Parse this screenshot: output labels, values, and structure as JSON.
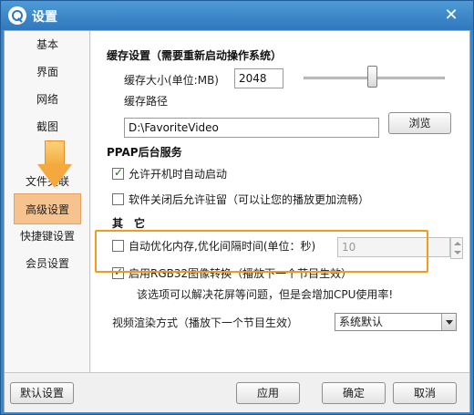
{
  "window": {
    "title": "设置",
    "close_glyph": "✕"
  },
  "sidebar": {
    "items": [
      {
        "label": "基本"
      },
      {
        "label": "界面"
      },
      {
        "label": "网络"
      },
      {
        "label": "截图"
      },
      {
        "label": "文件关联"
      },
      {
        "label": "高级设置"
      },
      {
        "label": "快捷键设置"
      },
      {
        "label": "会员设置"
      }
    ],
    "active_index": 5
  },
  "cache": {
    "section_title": "缓存设置（需要重新启动操作系统）",
    "size_label": "缓存大小(单位:MB)",
    "size_value": "2048",
    "path_label": "缓存路径",
    "path_value": "D:\\FavoriteVideo",
    "browse_label": "浏览"
  },
  "ppap": {
    "section_title": "PPAP后台服务",
    "autostart_label": "允许开机时自动启动",
    "autostart_checked": true,
    "stay_label": "软件关闭后允许驻留（可以让您的播放更加流畅）",
    "stay_checked": false
  },
  "other": {
    "section_title": "其　它",
    "optimize_label": "自动优化内存,优化间隔时间(单位：秒)",
    "optimize_checked": false,
    "optimize_value": "10",
    "rgb32_label": "启用RGB32图像转换（播放下一个节目生效）",
    "rgb32_checked": true,
    "rgb32_note": "该选项可以解决花屏等问题，但是会增加CPU使用率!",
    "render_label": "视频渲染方式（播放下一个节目生效）",
    "render_value": "系统默认"
  },
  "footer": {
    "default_label": "默认设置",
    "apply_label": "应用",
    "ok_label": "确定",
    "cancel_label": "取消"
  },
  "colors": {
    "accent_orange": "#f29b1d",
    "title_blue": "#3d86c6",
    "active_item": "#f6c28d"
  }
}
